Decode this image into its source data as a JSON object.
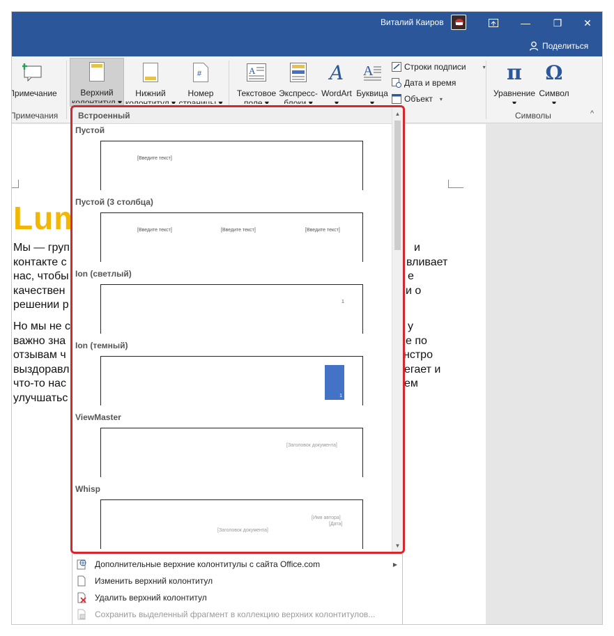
{
  "titlebar": {
    "user_name": "Виталий Каиров",
    "ribbon_display_icon": "ribbon-display-options-icon",
    "minimize_glyph": "—",
    "restore_glyph": "❐",
    "close_glyph": "✕",
    "share_label": "Поделиться",
    "accent": "#2b579a"
  },
  "ribbon": {
    "comment_label": "Примечание",
    "header_label": "Верхний",
    "header_label2": "колонтитул ▾",
    "footer_label": "Нижний",
    "footer_label2": "колонтитул ▾",
    "pagenum_label": "Номер",
    "pagenum_label2": "страницы ▾",
    "textbox_label": "Текстовое",
    "textbox_label2": "поле ▾",
    "quickparts_label": "Экспресс-",
    "quickparts_label2": "блоки ▾",
    "wordart_label": "WordArt",
    "dropcap_label": "Буквица",
    "signature_label": "Строки подписи",
    "datetime_label": "Дата и время",
    "object_label": "Объект",
    "equation_label": "Уравнение",
    "symbol_label": "Символ",
    "group_comments": "Примечания",
    "group_symbols": "Символы",
    "pi_glyph": "π",
    "omega_glyph": "Ω",
    "wordart_glyph": "A",
    "dropdown_glyph": "▾",
    "collapse_glyph": "^"
  },
  "document": {
    "title_fragment": "Lum",
    "para1": [
      "Мы — груп",
      "контакте с",
      "нас, чтобы",
      "качествен",
      "решении р"
    ],
    "para1_right": [
      "",
      "вливает",
      "е",
      "и о",
      ""
    ],
    "para1_right_top": "и",
    "para2": [
      "Но мы не с",
      "важно зна",
      "отзывам ч",
      "выздоравл",
      "что-то нас",
      "улучшатьс"
    ],
    "para2_right": [
      "у",
      "е по",
      "нстро",
      "егает и",
      "ем",
      ""
    ]
  },
  "gallery": {
    "section_label": "Встроенный",
    "items": [
      {
        "title": "Пустой",
        "placeholders": [
          "[Введите текст]"
        ]
      },
      {
        "title": "Пустой (3 столбца)",
        "placeholders": [
          "[Введите текст]",
          "[Введите текст]",
          "[Введите текст]"
        ]
      },
      {
        "title": "Ion (светлый)",
        "placeholders": [
          "1"
        ]
      },
      {
        "title": "Ion (темный)",
        "placeholders": [
          "1"
        ]
      },
      {
        "title": "ViewMaster",
        "placeholders": [
          "[Заголовок документа]"
        ]
      },
      {
        "title": "Whisp",
        "placeholders": [
          "[Имя автора]",
          "[Дата]",
          "[Заголовок документа]"
        ]
      }
    ],
    "ion_color": "#4472c4",
    "scroll_up_glyph": "▲",
    "scroll_down_glyph": "▼",
    "highlight_color": "#d6262e"
  },
  "menu": {
    "more_online": "Дополнительные верхние колонтитулы с сайта Office.com",
    "edit_header": "Изменить верхний колонтитул",
    "remove_header": "Удалить верхний колонтитул",
    "save_selection": "Сохранить выделенный фрагмент в коллекцию верхних колонтитулов...",
    "submenu_arrow": "▶"
  }
}
